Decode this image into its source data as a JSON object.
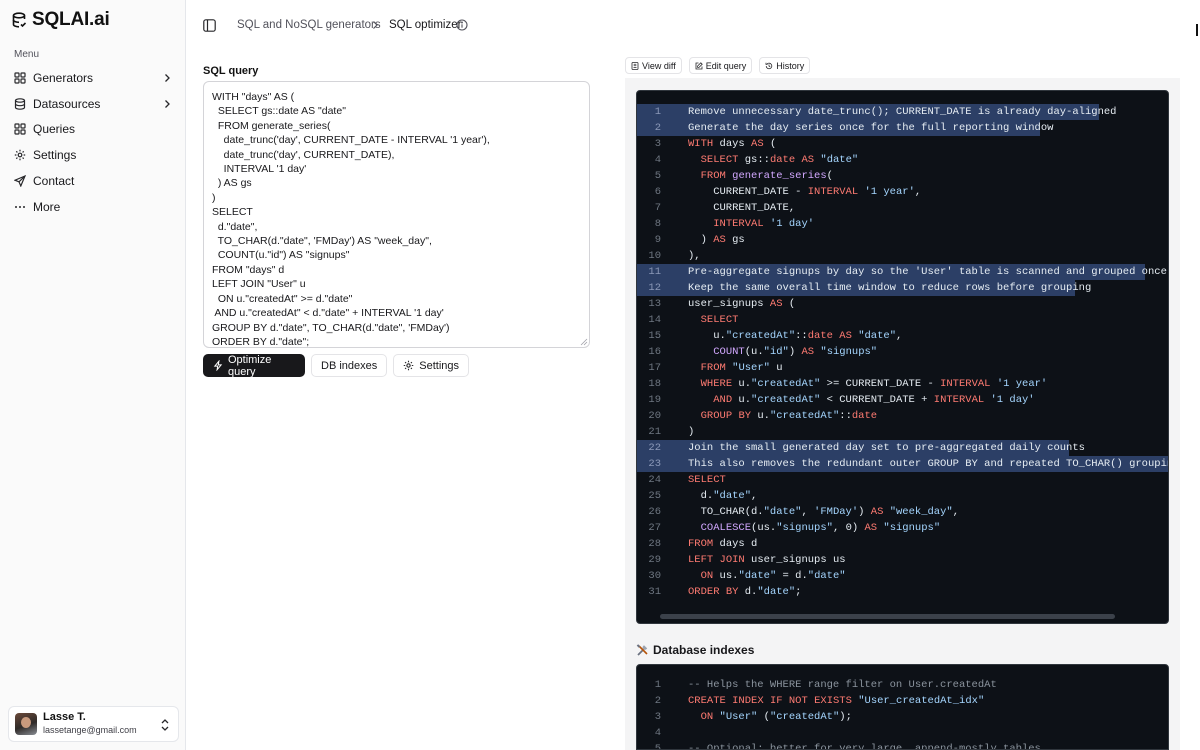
{
  "app": {
    "name": "SQLAI.ai"
  },
  "sidebar": {
    "menu_label": "Menu",
    "items": [
      {
        "label": "Generators",
        "icon": "grid-icon"
      },
      {
        "label": "Datasources",
        "icon": "database-icon"
      },
      {
        "label": "Queries",
        "icon": "grid-icon"
      },
      {
        "label": "Settings",
        "icon": "gear-icon"
      },
      {
        "label": "Contact",
        "icon": "send-icon"
      },
      {
        "label": "More",
        "icon": "ellipsis-icon"
      }
    ],
    "user": {
      "name": "Lasse T.",
      "email": "lassetange@gmail.com"
    }
  },
  "header": {
    "breadcrumb": [
      "SQL and NoSQL generators",
      "SQL optimizer"
    ]
  },
  "editor": {
    "label": "SQL query",
    "query": "WITH \"days\" AS (\n  SELECT gs::date AS \"date\"\n  FROM generate_series(\n    date_trunc('day', CURRENT_DATE - INTERVAL '1 year'),\n    date_trunc('day', CURRENT_DATE),\n    INTERVAL '1 day'\n  ) AS gs\n)\nSELECT\n  d.\"date\",\n  TO_CHAR(d.\"date\", 'FMDay') AS \"week_day\",\n  COUNT(u.\"id\") AS \"signups\"\nFROM \"days\" d\nLEFT JOIN \"User\" u\n  ON u.\"createdAt\" >= d.\"date\"\n AND u.\"createdAt\" < d.\"date\" + INTERVAL '1 day'\nGROUP BY d.\"date\", TO_CHAR(d.\"date\", 'FMDay')\nORDER BY d.\"date\";"
  },
  "buttons": {
    "optimize": "Optimize query",
    "db_indexes": "DB indexes",
    "settings": "Settings"
  },
  "toolbar": {
    "view_diff": "View diff",
    "edit_query": "Edit query",
    "history": "History"
  },
  "result": {
    "highlighted_lines": [
      1,
      2,
      11,
      12,
      22,
      23
    ],
    "lines": [
      "Remove unnecessary date_trunc(); CURRENT_DATE is already day-aligned",
      "Generate the day series once for the full reporting window",
      "WITH days AS (",
      "  SELECT gs::date AS \"date\"",
      "  FROM generate_series(",
      "    CURRENT_DATE - INTERVAL '1 year',",
      "    CURRENT_DATE,",
      "    INTERVAL '1 day'",
      "  ) AS gs",
      "),",
      "Pre-aggregate signups by day so the 'User' table is scanned and grouped once",
      "Keep the same overall time window to reduce rows before grouping",
      "user_signups AS (",
      "  SELECT",
      "    u.\"createdAt\"::date AS \"date\",",
      "    COUNT(u.\"id\") AS \"signups\"",
      "  FROM \"User\" u",
      "  WHERE u.\"createdAt\" >= CURRENT_DATE - INTERVAL '1 year'",
      "    AND u.\"createdAt\" < CURRENT_DATE + INTERVAL '1 day'",
      "  GROUP BY u.\"createdAt\"::date",
      ")",
      "Join the small generated day set to pre-aggregated daily counts",
      "This also removes the redundant outer GROUP BY and repeated TO_CHAR() grouping exp",
      "SELECT",
      "  d.\"date\",",
      "  TO_CHAR(d.\"date\", 'FMDay') AS \"week_day\",",
      "  COALESCE(us.\"signups\", 0) AS \"signups\"",
      "FROM days d",
      "LEFT JOIN user_signups us",
      "  ON us.\"date\" = d.\"date\"",
      "ORDER BY d.\"date\";"
    ]
  },
  "indexes": {
    "title": "Database indexes",
    "title_icon": "tools-icon",
    "lines": [
      "-- Helps the WHERE range filter on User.createdAt",
      "CREATE INDEX IF NOT EXISTS \"User_createdAt_idx\"",
      "  ON \"User\" (\"createdAt\");",
      "",
      "-- Optional: better for very large, append-mostly tables"
    ]
  }
}
